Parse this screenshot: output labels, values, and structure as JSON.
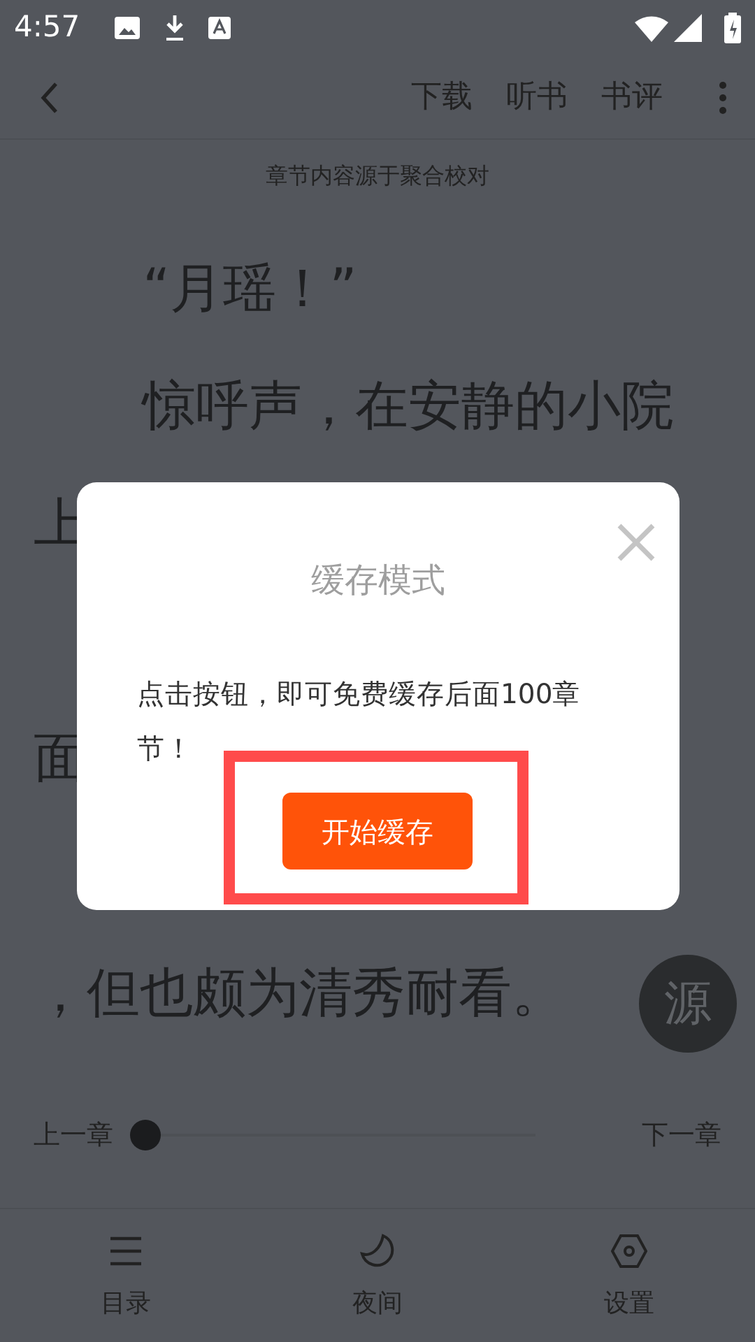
{
  "status_bar": {
    "time": "4:57"
  },
  "toolbar": {
    "actions": [
      "下载",
      "听书",
      "书评"
    ]
  },
  "source_note": "章节内容源于聚合校对",
  "lines": [
    {
      "text": "“月瑶！”",
      "indent": true
    },
    {
      "text": "惊呼声，在安静的小院",
      "indent": true
    },
    {
      "text": "上",
      "indent": false
    },
    {
      "text": "面",
      "indent": false
    },
    {
      "text": "，但也颇为清秀耐看。",
      "indent": false
    }
  ],
  "source_button": "源",
  "chapter_nav": {
    "prev": "上一章",
    "next": "下一章",
    "slider": {
      "level": 0
    }
  },
  "bottom_nav": [
    {
      "kind": "menu",
      "label": "目录"
    },
    {
      "kind": "moon",
      "label": "夜间"
    },
    {
      "kind": "settings",
      "label": "设置"
    }
  ],
  "dialog": {
    "title": "缓存模式",
    "message": "点击按钮，即可免费缓存后面100章节！",
    "button": "开始缓存",
    "highlighted": true
  }
}
